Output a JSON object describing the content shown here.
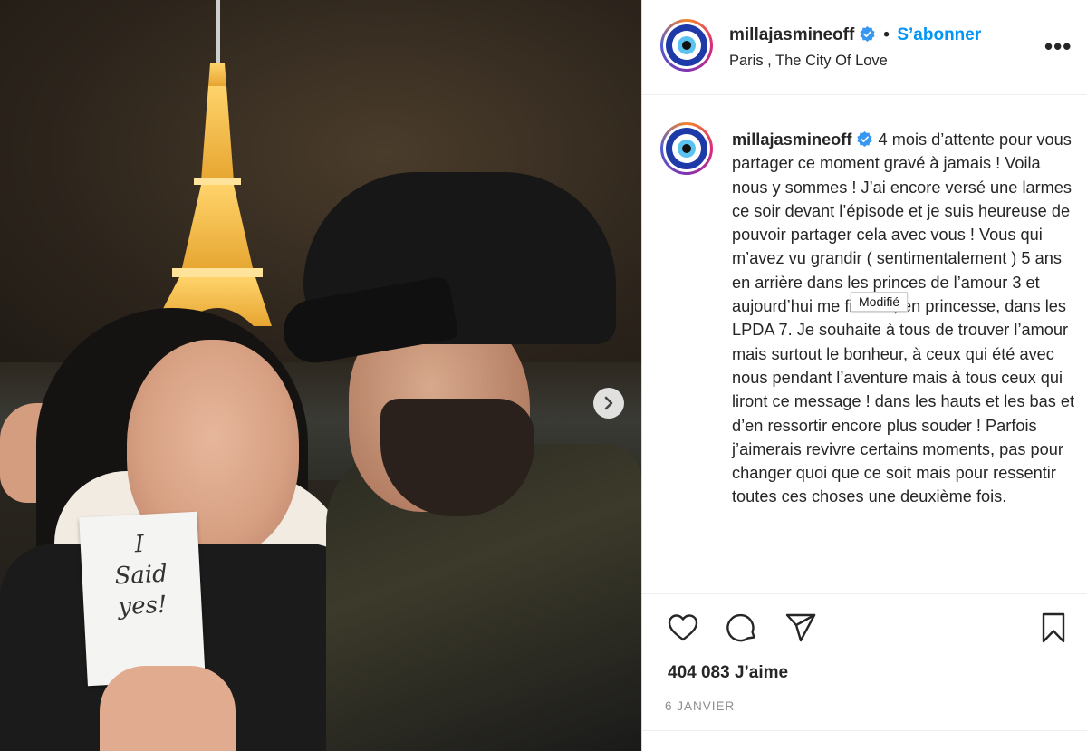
{
  "post": {
    "username": "millajasmineoff",
    "follow_label": "S’abonner",
    "separator": "•",
    "location": "Paris , The City Of Love",
    "more_label": "•••",
    "caption": "4 mois d’attente pour vous partager ce moment gravé à jamais ! Voila nous y sommes ! J’ai encore versé une larmes ce soir devant l’épisode et je suis heureuse de pouvoir partager cela avec vous ! Vous qui m’avez vu grandir ( sentimentalement ) 5 ans en arrière dans les princes de l’amour 3 et aujourd’hui me fiancer, en princesse, dans les LPDA 7. Je souhaite à tous de trouver l’amour mais surtout le bonheur, à ceux qui été avec nous pendant l’aventure mais à tous ceux qui liront ce message ! dans les hauts et les bas et d’en ressortir encore plus souder ! Parfois j’aimerais revivre certains moments, pas pour changer quoi que ce soit mais pour ressentir toutes ces choses une deuxième fois.",
    "tooltip": "Modifié",
    "likes": "404 083 J’aime",
    "date": "6 JANVIER"
  },
  "photo": {
    "note_lines": [
      "I",
      "Said",
      "yes!"
    ]
  },
  "icons": {
    "avatar": "evil-eye-icon",
    "verified": "verified-badge-icon",
    "like": "heart-icon",
    "comment": "comment-icon",
    "share": "paper-plane-icon",
    "save": "bookmark-icon",
    "next": "chevron-right-icon"
  },
  "colors": {
    "accent": "#0095f6",
    "verified": "#3897f0",
    "muted": "#8e8e8e"
  }
}
